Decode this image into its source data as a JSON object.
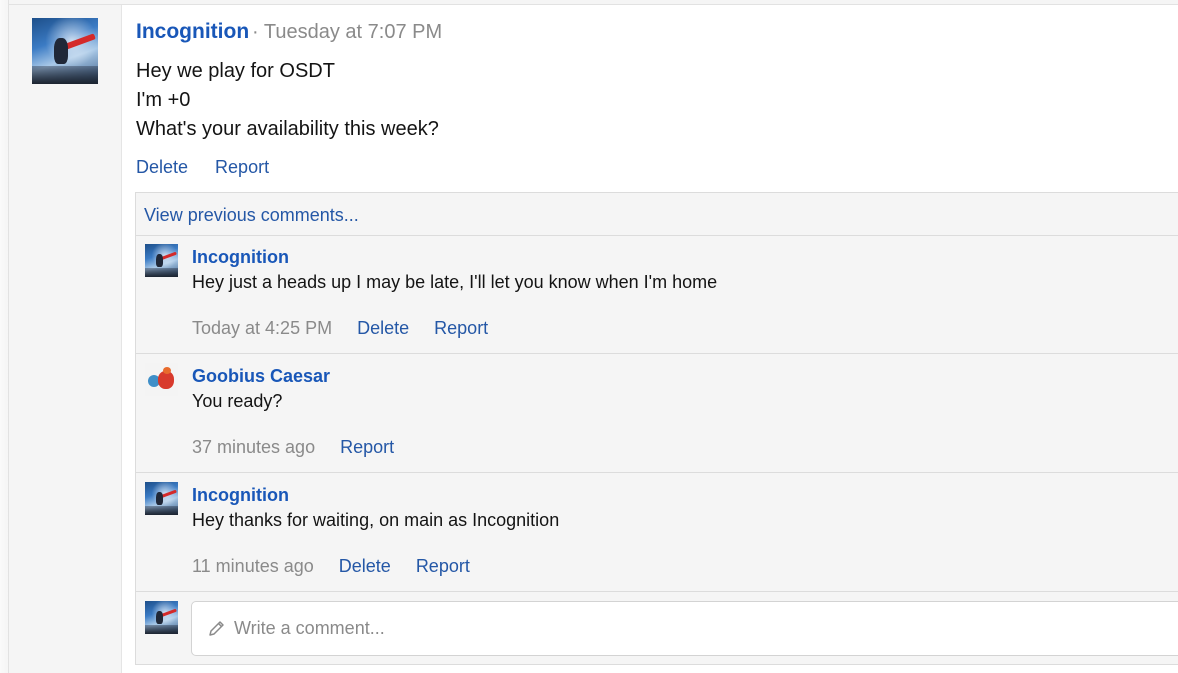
{
  "post": {
    "author": "Incognition",
    "separator": "·",
    "timestamp": "Tuesday at 7:07 PM",
    "lines": [
      "Hey we play for OSDT",
      "I'm +0",
      "What's your availability this week?"
    ],
    "actions": {
      "delete": "Delete",
      "report": "Report"
    }
  },
  "comments_section": {
    "view_previous": "View previous comments...",
    "comments": [
      {
        "author": "Incognition",
        "body": "Hey just a heads up I may be late, I'll let you know when I'm home",
        "time": "Today at 4:25 PM",
        "delete": "Delete",
        "report": "Report"
      },
      {
        "author": "Goobius Caesar",
        "body": "You ready?",
        "time": "37 minutes ago",
        "report": "Report"
      },
      {
        "author": "Incognition",
        "body": "Hey thanks for waiting, on main as Incognition",
        "time": "11 minutes ago",
        "delete": "Delete",
        "report": "Report"
      }
    ],
    "input": {
      "placeholder": "Write a comment..."
    }
  },
  "icons": {
    "comment_input_icon": "pencil-icon"
  },
  "colors": {
    "link": "#2457a6",
    "author": "#1957b8",
    "muted": "#8a8a8a",
    "panel_bg": "#f5f5f5"
  }
}
